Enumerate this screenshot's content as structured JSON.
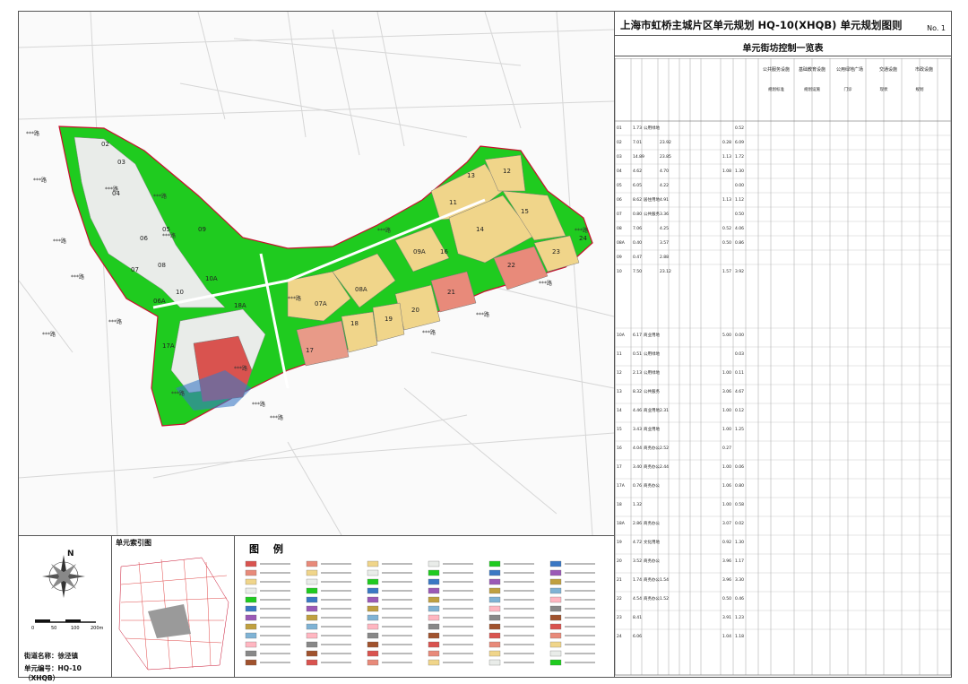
{
  "header": {
    "title": "上海市虹桥主城片区单元规划  HQ-10(XHQB) 单元规划图则",
    "number": "No. 1",
    "table_title": "单元街坊控制一览表"
  },
  "map": {
    "block_labels": [
      "02",
      "03",
      "04",
      "05",
      "06",
      "07",
      "08",
      "09",
      "10",
      "10A",
      "06A",
      "07A",
      "08A",
      "09A",
      "11",
      "12",
      "13",
      "14",
      "15",
      "16",
      "17",
      "17A",
      "18",
      "18A",
      "19",
      "20",
      "21",
      "22",
      "23",
      "24"
    ],
    "road_label": "***路"
  },
  "bottom": {
    "compass_label": "N",
    "scale_ticks": [
      "0",
      "50",
      "100",
      "200m"
    ],
    "street_name": "街道名称：徐泾镇",
    "unit_no": "单元编号：HQ-10（XHQB）",
    "index_title": "单元索引图",
    "legend_title": "图  例"
  },
  "table": {
    "header_groups": [
      "公共服务设施",
      "基础教育设施",
      "公用绿地广场",
      "交通设施",
      "市政设施"
    ],
    "header_sub": [
      "规划标准",
      "规划设施",
      "门诊",
      "现状",
      "规划"
    ],
    "rows": [
      [
        "01",
        "1.73",
        "公用绿地",
        "",
        "",
        "",
        "",
        "",
        "",
        "0.52"
      ],
      [
        "02",
        "7.01",
        "",
        "23.92",
        "",
        "",
        "",
        "",
        "0.28",
        "6.09"
      ],
      [
        "03",
        "14.89",
        "",
        "23.85",
        "",
        "",
        "",
        "",
        "1.13",
        "1.72"
      ],
      [
        "04",
        "4.62",
        "",
        "4.70",
        "",
        "",
        "",
        "",
        "1.08",
        "1.30"
      ],
      [
        "05",
        "6.05",
        "",
        "4.22",
        "",
        "",
        "",
        "",
        "",
        "0.00"
      ],
      [
        "06",
        "8.62",
        "居住用地",
        "4.91",
        "",
        "",
        "",
        "",
        "1.13",
        "1.12"
      ],
      [
        "07",
        "0.80",
        "公共服务",
        "3.36",
        "",
        "",
        "",
        "",
        "",
        "0.50"
      ],
      [
        "08",
        "7.06",
        "",
        "4.25",
        "",
        "",
        "",
        "",
        "0.52",
        "4.06"
      ],
      [
        "08A",
        "0.40",
        "",
        "3.57",
        "",
        "",
        "",
        "",
        "0.50",
        "0.86"
      ],
      [
        "09",
        "0.47",
        "",
        "2.88",
        "",
        "",
        "",
        "",
        "",
        ""
      ],
      [
        "10",
        "7.50",
        "",
        "23.12",
        "",
        "",
        "",
        "",
        "1.57",
        "3.92"
      ],
      [
        "10A",
        "6.17",
        "商业用地",
        "",
        "",
        "",
        "",
        "",
        "5.00",
        "0.00"
      ],
      [
        "11",
        "0.51",
        "公用绿地",
        "",
        "",
        "",
        "",
        "",
        "",
        "0.03"
      ],
      [
        "12",
        "2.13",
        "公用绿地",
        "",
        "",
        "",
        "",
        "",
        "1.00",
        "0.11"
      ],
      [
        "13",
        "8.32",
        "公共服务",
        "",
        "",
        "",
        "",
        "",
        "3.06",
        "4.67"
      ],
      [
        "14",
        "4.46",
        "商业用地",
        "2.31",
        "",
        "",
        "",
        "",
        "1.00",
        "0.12"
      ],
      [
        "15",
        "3.43",
        "商业用地",
        "",
        "",
        "",
        "",
        "",
        "1.00",
        "1.25"
      ],
      [
        "16",
        "4.04",
        "商务办公",
        "2.52",
        "",
        "",
        "",
        "",
        "0.27",
        ""
      ],
      [
        "17",
        "3.40",
        "商务办公",
        "2.44",
        "",
        "",
        "",
        "",
        "1.00",
        "0.06"
      ],
      [
        "17A",
        "0.76",
        "商务办公",
        "",
        "",
        "",
        "",
        "",
        "1.06",
        "0.80"
      ],
      [
        "18",
        "1.32",
        "",
        "",
        "",
        "",
        "",
        "",
        "1.00",
        "0.58"
      ],
      [
        "18A",
        "2.86",
        "商务办公",
        "",
        "",
        "",
        "",
        "",
        "3.07",
        "0.02"
      ],
      [
        "19",
        "4.72",
        "文化用地",
        "",
        "",
        "",
        "",
        "",
        "0.92",
        "1.30"
      ],
      [
        "20",
        "3.52",
        "商务办公",
        "",
        "",
        "",
        "",
        "",
        "3.96",
        "1.17"
      ],
      [
        "21",
        "1.74",
        "商务办公",
        "1.54",
        "",
        "",
        "",
        "",
        "3.96",
        "3.30"
      ],
      [
        "22",
        "4.54",
        "商务办公",
        "1.52",
        "",
        "",
        "",
        "",
        "0.50",
        "0.46"
      ],
      [
        "23",
        "8.41",
        "",
        "",
        "",
        "",
        "",
        "",
        "3.91",
        "1.23"
      ],
      [
        "24",
        "6.06",
        "",
        "",
        "",
        "",
        "",
        "",
        "1.04",
        "1.18"
      ]
    ]
  },
  "colors": {
    "green_space": "#1fcb1f",
    "residential": "#f4f4f0",
    "commercial": "#f0d58a",
    "office": "#e8a080",
    "public": "#d9534f",
    "boundary": "#c8102e",
    "water": "#3a78c4",
    "road": "#dcdcdc"
  }
}
